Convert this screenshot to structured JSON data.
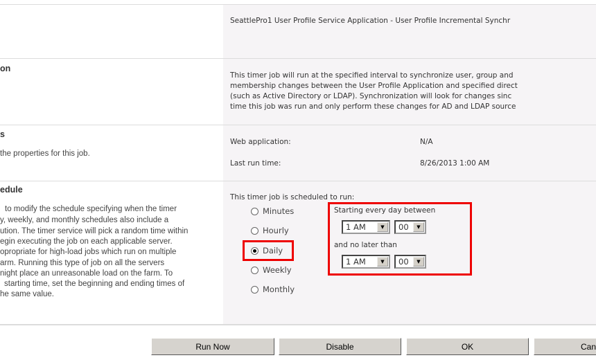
{
  "title_row": {
    "value": "SeattlePro1 User Profile Service Application - User Profile Incremental Synchr"
  },
  "description": {
    "heading": "on",
    "lines": [
      "This timer job will run at the specified interval to synchronize user, group and",
      "membership changes between the User Profile Application and specified direct",
      "(such as Active Directory or LDAP). Synchronization will look for changes sinc",
      "time this job was run and only perform these changes for AD and LDAP source"
    ]
  },
  "properties": {
    "heading": "s",
    "text": "the properties for this job.",
    "web_app_label": "Web application:",
    "web_app_value": "N/A",
    "last_run_label": "Last run time:",
    "last_run_value": "8/26/2013 1:00 AM"
  },
  "schedule": {
    "heading": "edule",
    "help_lines": [
      "to modify the schedule specifying when the timer",
      "y, weekly, and monthly schedules also include a",
      "ution. The timer service will pick a random time within",
      "egin executing the job on each applicable server.",
      "opropriate for high-load jobs which run on multiple",
      "arm. Running this type of job on all the servers",
      "night place an unreasonable load on the farm. To",
      "starting time, set the beginning and ending times of",
      "he same value."
    ],
    "intro": "This timer job is scheduled to run:",
    "options": [
      {
        "label": "Minutes",
        "selected": false
      },
      {
        "label": "Hourly",
        "selected": false
      },
      {
        "label": "Daily",
        "selected": true
      },
      {
        "label": "Weekly",
        "selected": false
      },
      {
        "label": "Monthly",
        "selected": false
      }
    ],
    "start_label": "Starting every day between",
    "start_hour": "1 AM",
    "start_minute": "00",
    "end_label": "and no later than",
    "end_hour": "1 AM",
    "end_minute": "00",
    "highlight_color": "#e00000"
  },
  "buttons": {
    "run_now": "Run Now",
    "disable": "Disable",
    "ok": "OK",
    "cancel": "Can"
  }
}
